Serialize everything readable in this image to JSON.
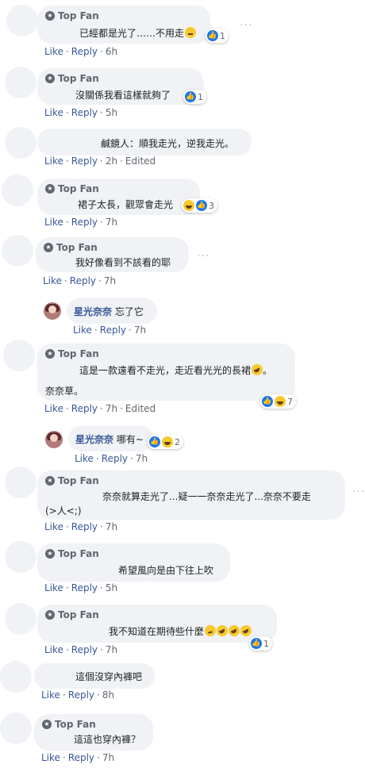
{
  "labels": {
    "top_fan": "Top Fan",
    "like": "Like",
    "reply": "Reply",
    "edited": "Edited",
    "more": "···"
  },
  "comments": [
    {
      "text": "已經都是光了……不用走",
      "time": "6h",
      "reaction_count": "1"
    },
    {
      "text": "沒關係我看這樣就夠了",
      "time": "5h",
      "reaction_count": "1"
    },
    {
      "text": "鹹鏡人：順我走光，逆我走光。",
      "time": "2h"
    },
    {
      "text": "裙子太長，觀眾會走光",
      "time": "7h",
      "reaction_count": "3"
    },
    {
      "text": "我好像看到不該看的耶",
      "time": "7h"
    },
    {
      "author": "星光奈奈",
      "text": "忘了它",
      "time": "7h"
    },
    {
      "text_line1": "這是一款遠看不走光，走近看光光的長裙",
      "text_line2": "奈奈草。",
      "time": "7h",
      "reaction_count": "7"
    },
    {
      "author": "星光奈奈",
      "text": "哪有~",
      "time": "7h",
      "reaction_count": "2"
    },
    {
      "text_line1": "奈奈就算走光了...疑一一奈奈走光了...奈奈不要走",
      "text_line2": "(>人<;)",
      "time": "7h"
    },
    {
      "text": "希望風向是由下往上吹",
      "time": "5h"
    },
    {
      "text": "我不知道在期待些什麼",
      "time": "7h",
      "reaction_count": "1"
    },
    {
      "text": "這個沒穿內褲吧",
      "time": "8h"
    },
    {
      "text": "這這也穿內褲？",
      "time": "7h"
    }
  ]
}
